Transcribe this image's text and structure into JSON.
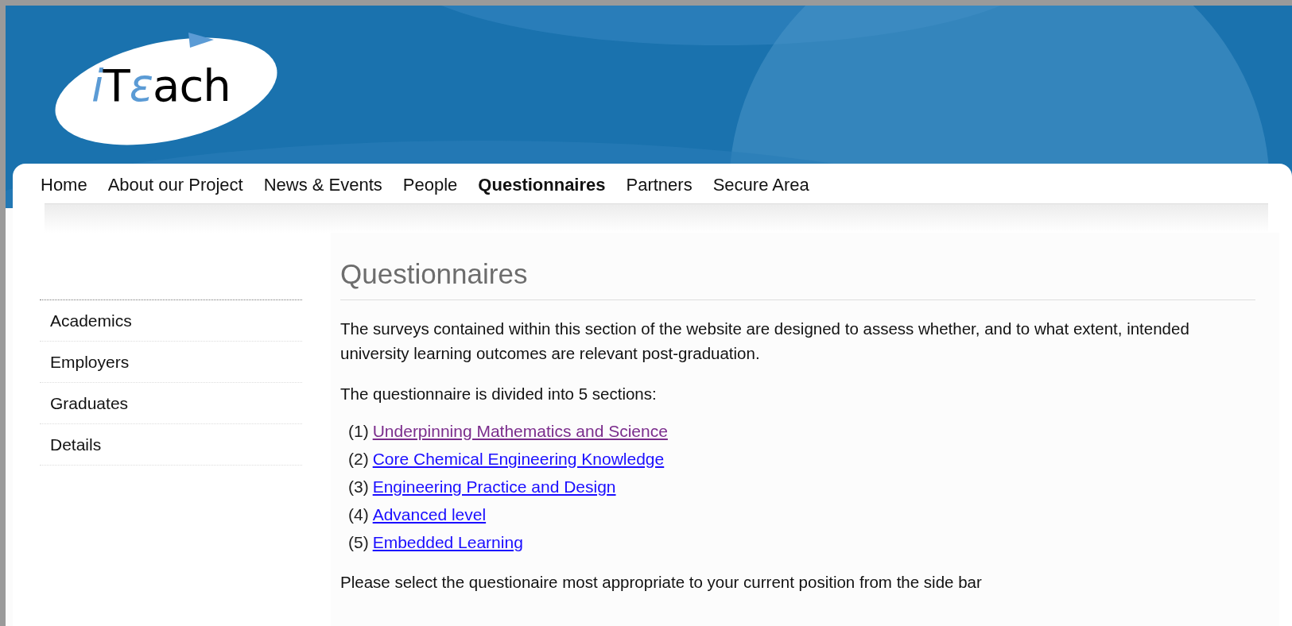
{
  "logo": {
    "parts": [
      {
        "text": "i",
        "accent": true
      },
      {
        "text": "T",
        "accent": false
      },
      {
        "text": "ε",
        "accent": true
      },
      {
        "text": "ach",
        "accent": false
      }
    ]
  },
  "nav": [
    {
      "label": "Home",
      "selected": false
    },
    {
      "label": "About our Project",
      "selected": false
    },
    {
      "label": "News & Events",
      "selected": false
    },
    {
      "label": "People",
      "selected": false
    },
    {
      "label": "Questionnaires",
      "selected": true
    },
    {
      "label": "Partners",
      "selected": false
    },
    {
      "label": "Secure Area",
      "selected": false
    }
  ],
  "sidebar": {
    "items": [
      "Academics",
      "Employers",
      "Graduates",
      "Details"
    ]
  },
  "main": {
    "title": "Questionnaires",
    "intro": "The surveys contained within this section of the website are designed to assess whether, and to what extent, intended university learning outcomes are relevant post-graduation.",
    "list_intro": "The questionnaire is divided into 5 sections:",
    "sections": [
      {
        "number": "(1)",
        "link": "Underpinning Mathematics and Science",
        "visited": true
      },
      {
        "number": "(2)",
        "link": "Core Chemical Engineering Knowledge",
        "visited": false
      },
      {
        "number": "(3)",
        "link": "Engineering Practice and Design",
        "visited": false
      },
      {
        "number": "(4)",
        "link": "Advanced level",
        "visited": false
      },
      {
        "number": "(5)",
        "link": "Embedded Learning",
        "visited": false
      }
    ],
    "footer": "Please select the questionaire most appropriate to your current position from the side bar"
  }
}
